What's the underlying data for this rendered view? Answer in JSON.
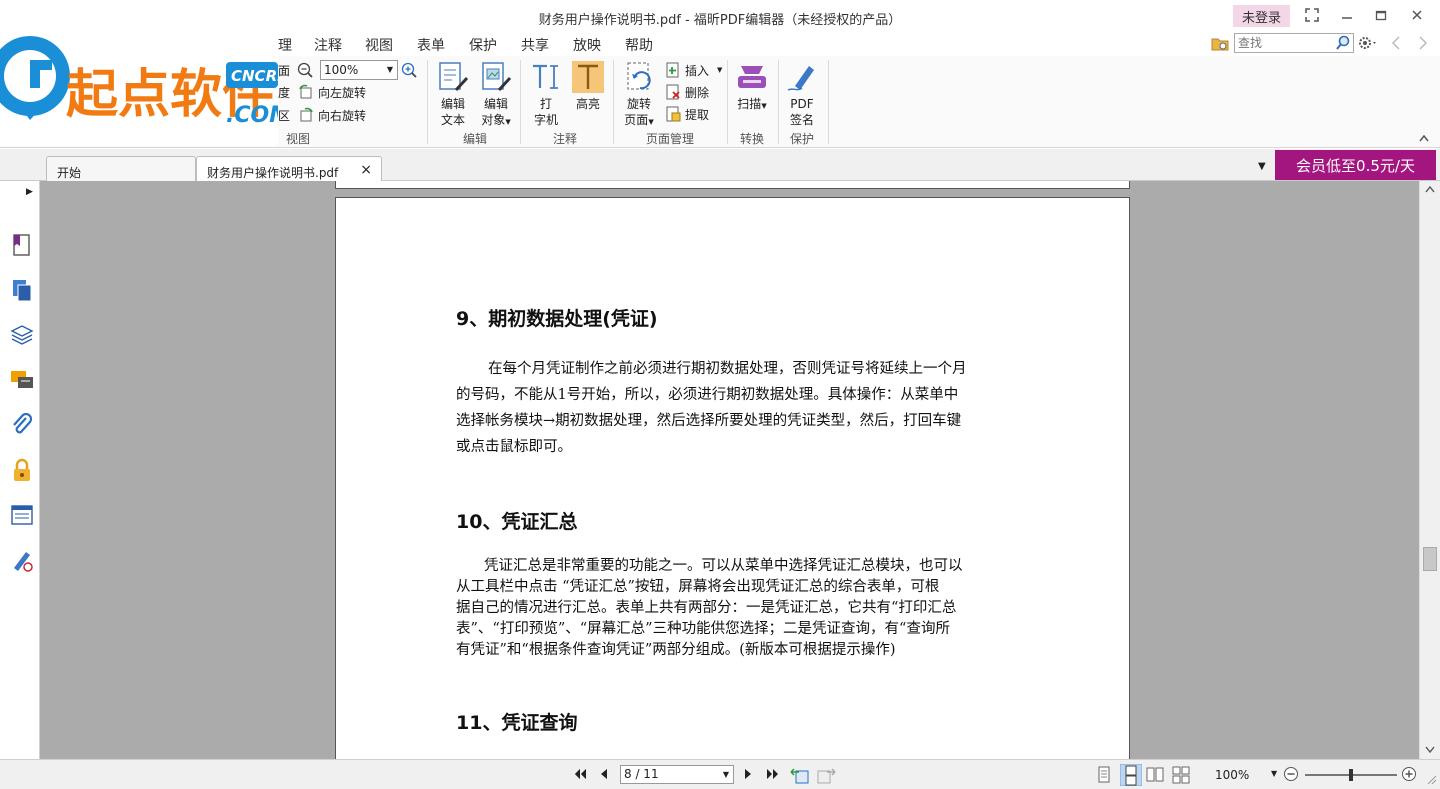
{
  "window": {
    "title": "财务用户操作说明书.pdf - 福昕PDF编辑器（未经授权的产品）",
    "login": "未登录"
  },
  "menu": [
    "理",
    "注释",
    "视图",
    "表单",
    "保护",
    "共享",
    "放映",
    "帮助"
  ],
  "search": {
    "placeholder": "查找"
  },
  "logo": {
    "text": "起点软件",
    "badge_top": "CNCRK",
    "badge_bottom": ".COM"
  },
  "ribbon": {
    "view": {
      "partial_labels": [
        "面",
        "度",
        "区"
      ],
      "zoom_value": "100%",
      "rotate_left": "向左旋转",
      "rotate_right": "向右旋转",
      "group": "视图"
    },
    "edit": {
      "edit_text_1": "编辑",
      "edit_text_2": "文本",
      "edit_obj_1": "编辑",
      "edit_obj_2": "对象",
      "group": "编辑"
    },
    "annot": {
      "type_1": "打",
      "type_2": "字机",
      "highlight": "高亮",
      "group": "注释"
    },
    "pages": {
      "rotate_1": "旋转",
      "rotate_2": "页面",
      "insert": "插入",
      "delete": "删除",
      "extract": "提取",
      "group": "页面管理"
    },
    "convert": {
      "scan": "扫描",
      "group": "转换"
    },
    "protect": {
      "sign_1": "PDF",
      "sign_2": "签名",
      "group": "保护"
    }
  },
  "tabs": {
    "home": "开始",
    "doc": "财务用户操作说明书.pdf",
    "close": "×"
  },
  "vip": "会员低至0.5元/天",
  "document": {
    "sec9_title": "9、期初数据处理(凭证)",
    "sec9_lines": [
      "在每个月凭证制作之前必须进行期初数据处理，否则凭证号将延续上一个月",
      "的号码，不能从1号开始，所以，必须进行期初数据处理。具体操作：从菜单中",
      "选择帐务模块→期初数据处理，然后选择所要处理的凭证类型，然后，打回车键",
      "或点击鼠标即可。"
    ],
    "sec10_title": "10、凭证汇总",
    "sec10_lines": [
      "凭证汇总是非常重要的功能之一。可以从菜单中选择凭证汇总模块，也可以",
      "从工具栏中点击 “凭证汇总”按钮，屏幕将会出现凭证汇总的综合表单，可根",
      "据自己的情况进行汇总。表单上共有两部分：一是凭证汇总，它共有“打印汇总",
      "表”、“打印预览”、“屏幕汇总”三种功能供您选择；二是凭证查询，有“查询所",
      "有凭证”和“根据条件查询凭证”两部分组成。(新版本可根据提示操作)"
    ],
    "sec11_title": "11、凭证查询"
  },
  "status": {
    "page": "8 / 11",
    "zoom": "100%"
  },
  "colors": {
    "accent": "#a3157f",
    "viewer_bg": "#ababab",
    "logo_blue": "#1a8fd8",
    "logo_orange": "#f27a12"
  }
}
